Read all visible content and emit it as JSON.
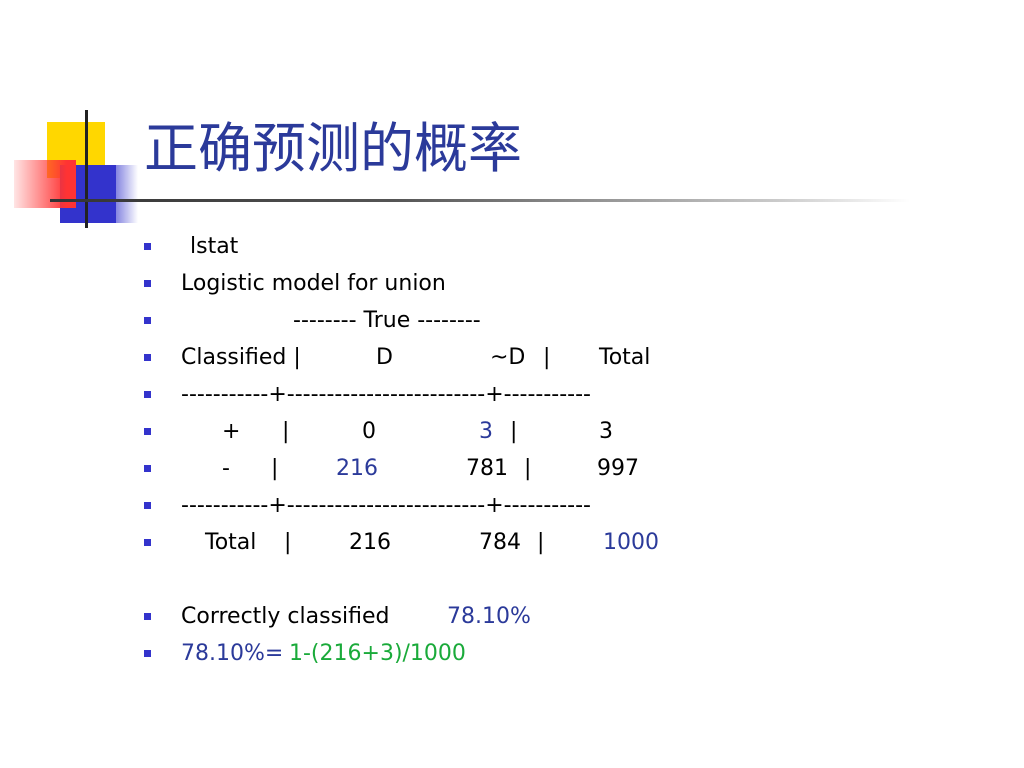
{
  "title": "正确预测的概率",
  "colors": {
    "title": "#2b3a9a",
    "bullet": "#3333cc",
    "highlight_blue": "#2b3a9a",
    "highlight_green": "#1aaa3a"
  },
  "lines": {
    "lstat": "lstat",
    "model": "Logistic model for union",
    "true_header": "-------- True --------",
    "classified_header": {
      "label": "Classified |",
      "d": "D",
      "nd": "~D",
      "sep": "|",
      "total": "Total"
    },
    "divider1": "-----------+-------------------------+-----------",
    "row_plus": {
      "sign": "+",
      "sep1": "|",
      "d": "0",
      "nd": "3",
      "sep2": "|",
      "total": "3"
    },
    "row_minus": {
      "sign": "-",
      "sep1": "|",
      "d": "216",
      "nd": "781",
      "sep2": "|",
      "total": "997"
    },
    "divider2": "-----------+-------------------------+-----------",
    "row_total": {
      "label": "Total",
      "sep1": "|",
      "d": "216",
      "nd": "784",
      "sep2": "|",
      "total": "1000"
    },
    "correct": {
      "label": "Correctly classified",
      "value": "78.10%"
    },
    "formula": {
      "left": "78.10%=",
      "right": "1-(216+3)/1000"
    }
  }
}
